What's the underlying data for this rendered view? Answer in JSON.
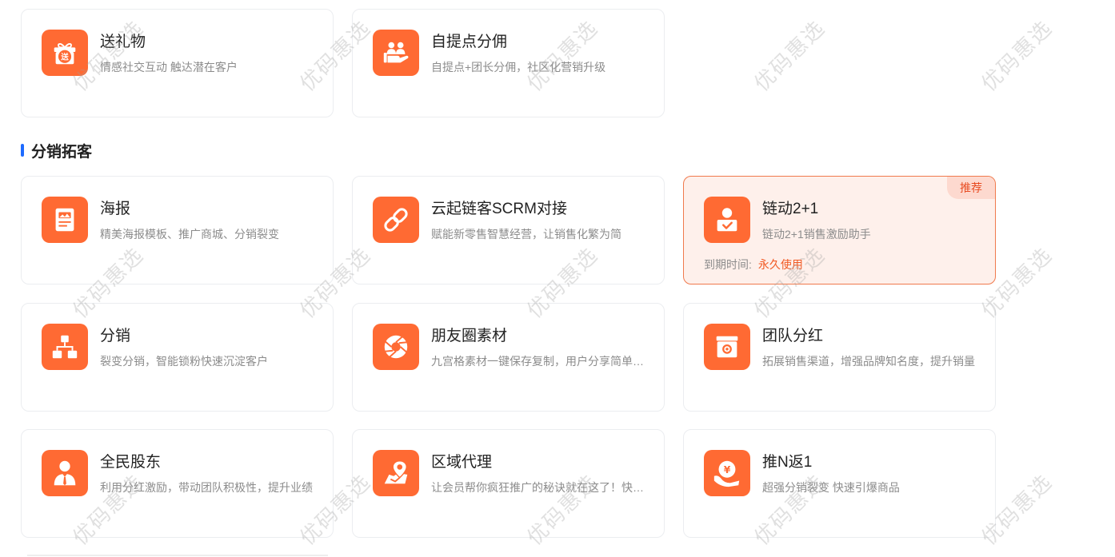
{
  "top_cards": [
    {
      "title": "送礼物",
      "desc": "情感社交互动 触达潜在客户",
      "icon": "gift-icon"
    },
    {
      "title": "自提点分佣",
      "desc": "自提点+团长分佣，社区化营销升级",
      "icon": "group-hands-icon"
    }
  ],
  "section": {
    "title": "分销拓客"
  },
  "cards": [
    {
      "title": "海报",
      "desc": "精美海报模板、推广商城、分销裂变",
      "icon": "poster-icon"
    },
    {
      "title": "云起链客SCRM对接",
      "desc": "赋能新零售智慧经营，让销售化繁为简",
      "icon": "link-icon"
    },
    {
      "title": "链动2+1",
      "desc": "链动2+1销售激励助手",
      "icon": "user-badge-icon",
      "badge": "推荐",
      "expire_label": "到期时间:",
      "expire_value": "永久使用"
    },
    {
      "title": "分销",
      "desc": "裂变分销，智能锁粉快速沉淀客户",
      "icon": "org-chart-icon"
    },
    {
      "title": "朋友圈素材",
      "desc": "九宫格素材一键保存复制，用户分享简单便捷",
      "icon": "aperture-icon"
    },
    {
      "title": "团队分红",
      "desc": "拓展销售渠道，增强品牌知名度，提升销量",
      "icon": "dividend-box-icon"
    },
    {
      "title": "全民股东",
      "desc": "利用分红激励，带动团队积极性，提升业绩",
      "icon": "shareholder-icon"
    },
    {
      "title": "区域代理",
      "desc": "让会员帮你疯狂推广的秘诀就在这了！快来试试",
      "icon": "map-pin-icon"
    },
    {
      "title": "推N返1",
      "desc": "超强分销裂变 快速引爆商品",
      "icon": "yuan-coin-hand-icon"
    }
  ],
  "watermark": "优码惠选",
  "colors": {
    "icon_bg": "#ff6a33",
    "accent_blue": "#1e6bff",
    "recommend_bg": "#fef0eb",
    "recommend_border": "#f07a4d",
    "expire_value": "#f15a24"
  }
}
